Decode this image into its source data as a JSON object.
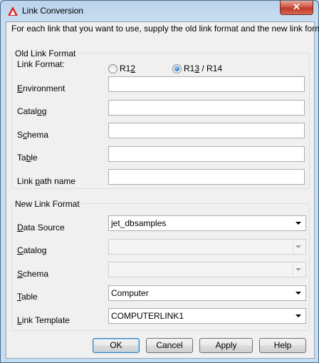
{
  "window": {
    "title": "Link Conversion",
    "close_glyph": "✕"
  },
  "instructions": "For each link that you want to use, supply the old link format and the new link format.",
  "old_format": {
    "group_label": "Old Link Format",
    "link_format_label": "Link Format:",
    "radio_r12": {
      "pre": "R1",
      "key": "2",
      "post": "",
      "checked": false
    },
    "radio_r13": {
      "pre": "R1",
      "key": "3",
      "post": " / R14",
      "checked": true
    },
    "environment": {
      "key": "E",
      "rest": "nvironment",
      "value": ""
    },
    "catalog": {
      "pre": "Catal",
      "key": "o",
      "post": "g",
      "value": ""
    },
    "schema": {
      "pre": "S",
      "key": "c",
      "post": "hema",
      "value": ""
    },
    "table": {
      "pre": "Ta",
      "key": "b",
      "post": "le",
      "value": ""
    },
    "link_path": {
      "pre": "Link ",
      "key": "p",
      "post": "ath name",
      "value": ""
    }
  },
  "new_format": {
    "group_label": "New Link Format",
    "data_source": {
      "key": "D",
      "post": "ata Source",
      "value": "jet_dbsamples"
    },
    "catalog": {
      "key": "C",
      "post": "atalog",
      "value": ""
    },
    "schema": {
      "pre": "",
      "key": "S",
      "post": "chema",
      "value": ""
    },
    "table": {
      "key": "T",
      "post": "able",
      "value": "Computer"
    },
    "link_template": {
      "key": "L",
      "post": "ink Template",
      "value": "COMPUTERLINK1"
    }
  },
  "buttons": {
    "ok": "OK",
    "cancel": "Cancel",
    "apply": "Apply",
    "help": "Help"
  },
  "colors": {
    "accent": "#3c7fb1",
    "title_bg": "#c8dcf1",
    "close_red": "#c03a2c"
  }
}
